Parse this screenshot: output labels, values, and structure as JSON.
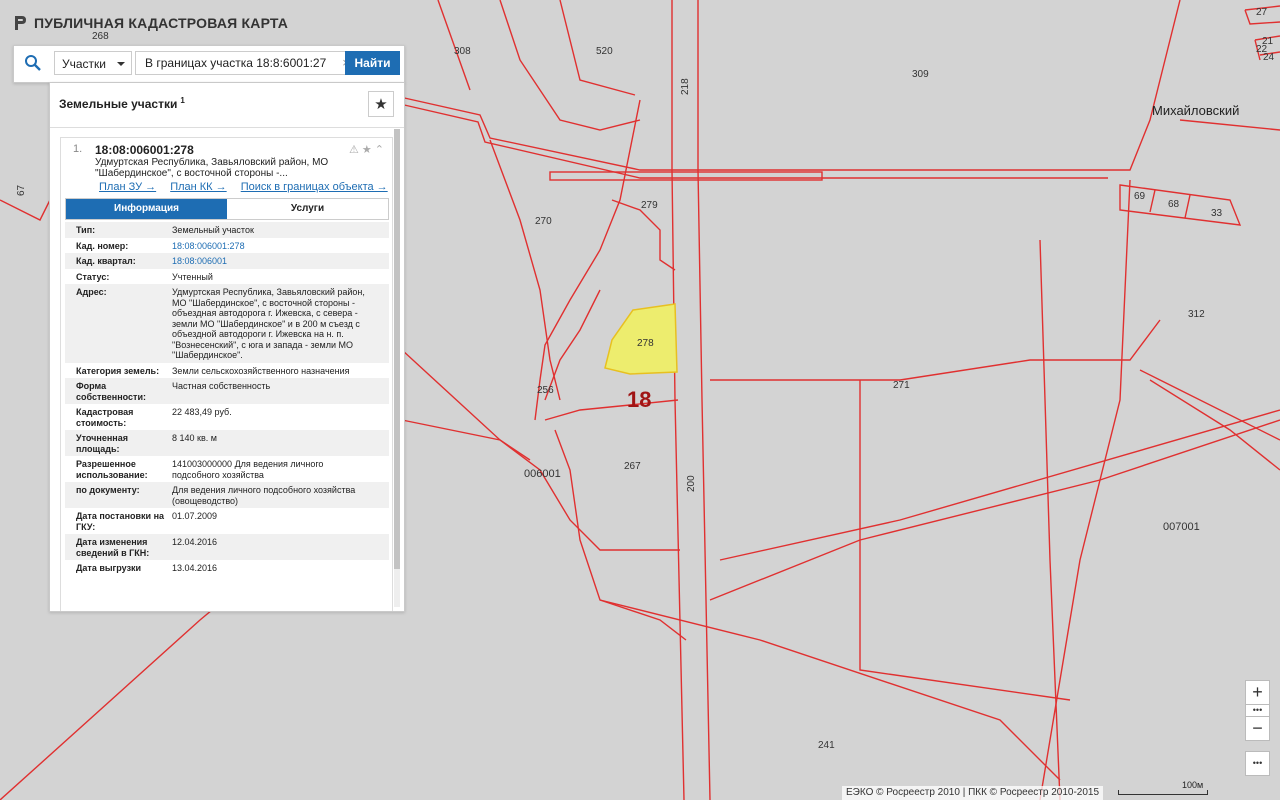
{
  "header": {
    "title": "ПУБЛИЧНАЯ КАДАСТРОВАЯ КАРТА"
  },
  "search": {
    "type_label": "Участки",
    "query": "В границах участка 18:8:6001:27",
    "clear_icon": "×",
    "submit_label": "Найти"
  },
  "panel": {
    "title": "Земельные участки",
    "count": "1",
    "result": {
      "index": "1.",
      "cad_number": "18:08:006001:278",
      "address_snippet": "Удмуртская Республика, Завьяловский район, МО \"Шабердинское\", с восточной стороны -...",
      "links": [
        "План ЗУ →",
        "План КК →",
        "Поиск в границах объекта →"
      ],
      "tabs": [
        "Информация",
        "Услуги"
      ],
      "attributes": [
        {
          "key": "Тип:",
          "value": "Земельный участок"
        },
        {
          "key": "Кад. номер:",
          "value": "18:08:006001:278"
        },
        {
          "key": "Кад. квартал:",
          "value": "18:08:006001"
        },
        {
          "key": "Статус:",
          "value": "Учтенный"
        },
        {
          "key": "Адрес:",
          "value": "Удмуртская Республика, Завьяловский район, МО \"Шабердинское\", с восточной стороны - объездная автодорога г. Ижевска, с севера - земли МО \"Шабердинское\" и в 200 м съезд с объездной автодороги г. Ижевска на н. п. \"Вознесенский\", с юга и запада - земли МО \"Шабердинское\"."
        },
        {
          "key": "Категория земель:",
          "value": "Земли сельскохозяйственного назначения"
        },
        {
          "key": "Форма собственности:",
          "value": "Частная собственность"
        },
        {
          "key": "Кадастровая стоимость:",
          "value": "22 483,49 руб."
        },
        {
          "key": "Уточненная площадь:",
          "value": "8 140 кв. м"
        },
        {
          "key": "Разрешенное использование:",
          "value": "141003000000 Для ведения личного подсобного хозяйства"
        },
        {
          "key": "по документу:",
          "value": "Для ведения личного подсобного хозяйства (овощеводство)"
        },
        {
          "key": "Дата постановки на ГКУ:",
          "value": "01.07.2009"
        },
        {
          "key": "Дата изменения сведений в ГКН:",
          "value": "12.04.2016"
        },
        {
          "key": "Дата выгрузки",
          "value": "13.04.2016"
        }
      ]
    }
  },
  "map": {
    "labels": {
      "p268": "268",
      "p308": "308",
      "p520": "520",
      "p218": "218",
      "p309": "309",
      "town": "Михайловский",
      "p279": "279",
      "p270": "270",
      "p278": "278",
      "p256": "256",
      "quarter18": "18",
      "p271": "271",
      "p312": "312",
      "p267": "267",
      "q006001": "006001",
      "p200": "200",
      "q007001": "007001",
      "p241": "241",
      "p69": "69",
      "p68": "68",
      "p33": "33",
      "p67": "67",
      "p21": "21",
      "p22": "22",
      "p24": "24",
      "p27": "27"
    },
    "selected_fill": "#eded6e",
    "boundary_color": "#e03030"
  },
  "zoom": {
    "in": "+",
    "out": "−",
    "more": "•••"
  },
  "footer": {
    "credits": "ЕЭКО © Росреестр 2010 | ПКК © Росреестр 2010-2015",
    "scale_label": "100м"
  }
}
